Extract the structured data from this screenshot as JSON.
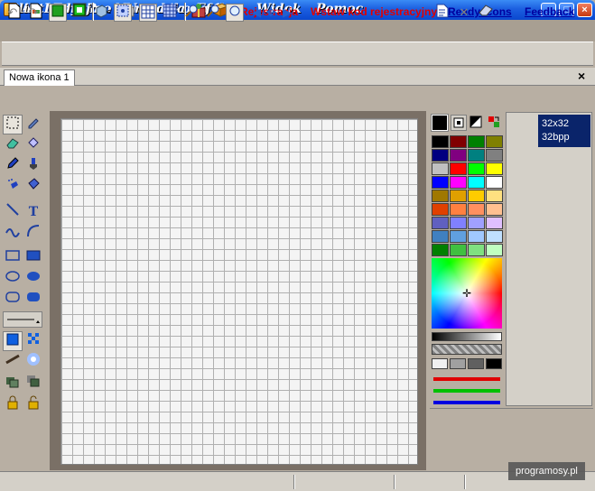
{
  "window": {
    "title": "ArtIcons Pro - Nowa ikona 1",
    "buttons": {
      "minimize": "_",
      "maximize": "□",
      "close": "×"
    }
  },
  "menu": [
    "Plik",
    "Edycja",
    "Narzędzia",
    "Efekty",
    "Widok",
    "Pomoc"
  ],
  "toolbar": {
    "links": [
      "Rejestracja",
      "Wstaw kod rejestracyjny",
      "Ready Icons",
      "Feedback"
    ]
  },
  "tabs": {
    "active": "Nowa ikona 1",
    "close": "×"
  },
  "formats": [
    {
      "size": "32x32",
      "depth": "32bpp"
    }
  ],
  "palette": {
    "colors": [
      "#000000",
      "#800000",
      "#008000",
      "#808000",
      "#000080",
      "#800080",
      "#008080",
      "#808080",
      "#c0c0c0",
      "#ff0000",
      "#00ff00",
      "#ffff00",
      "#0000ff",
      "#ff00ff",
      "#00ffff",
      "#ffffff",
      "#a07800",
      "#e0a000",
      "#ffcc00",
      "#ffe080",
      "#e04000",
      "#ff8040",
      "#ff9060",
      "#ffc090",
      "#6060c0",
      "#8080ff",
      "#a0a0ff",
      "#e0c0ff",
      "#4080c0",
      "#60a0e0",
      "#a0c8ff",
      "#c0e0ff",
      "#008000",
      "#40c040",
      "#80e080",
      "#c0ffc0"
    ]
  },
  "watermark": "programosy.pl",
  "colors": {
    "title": "#1c5fe0",
    "menu": "#a89f92",
    "link_red": "#e00000",
    "link_blue": "#0000a0"
  }
}
